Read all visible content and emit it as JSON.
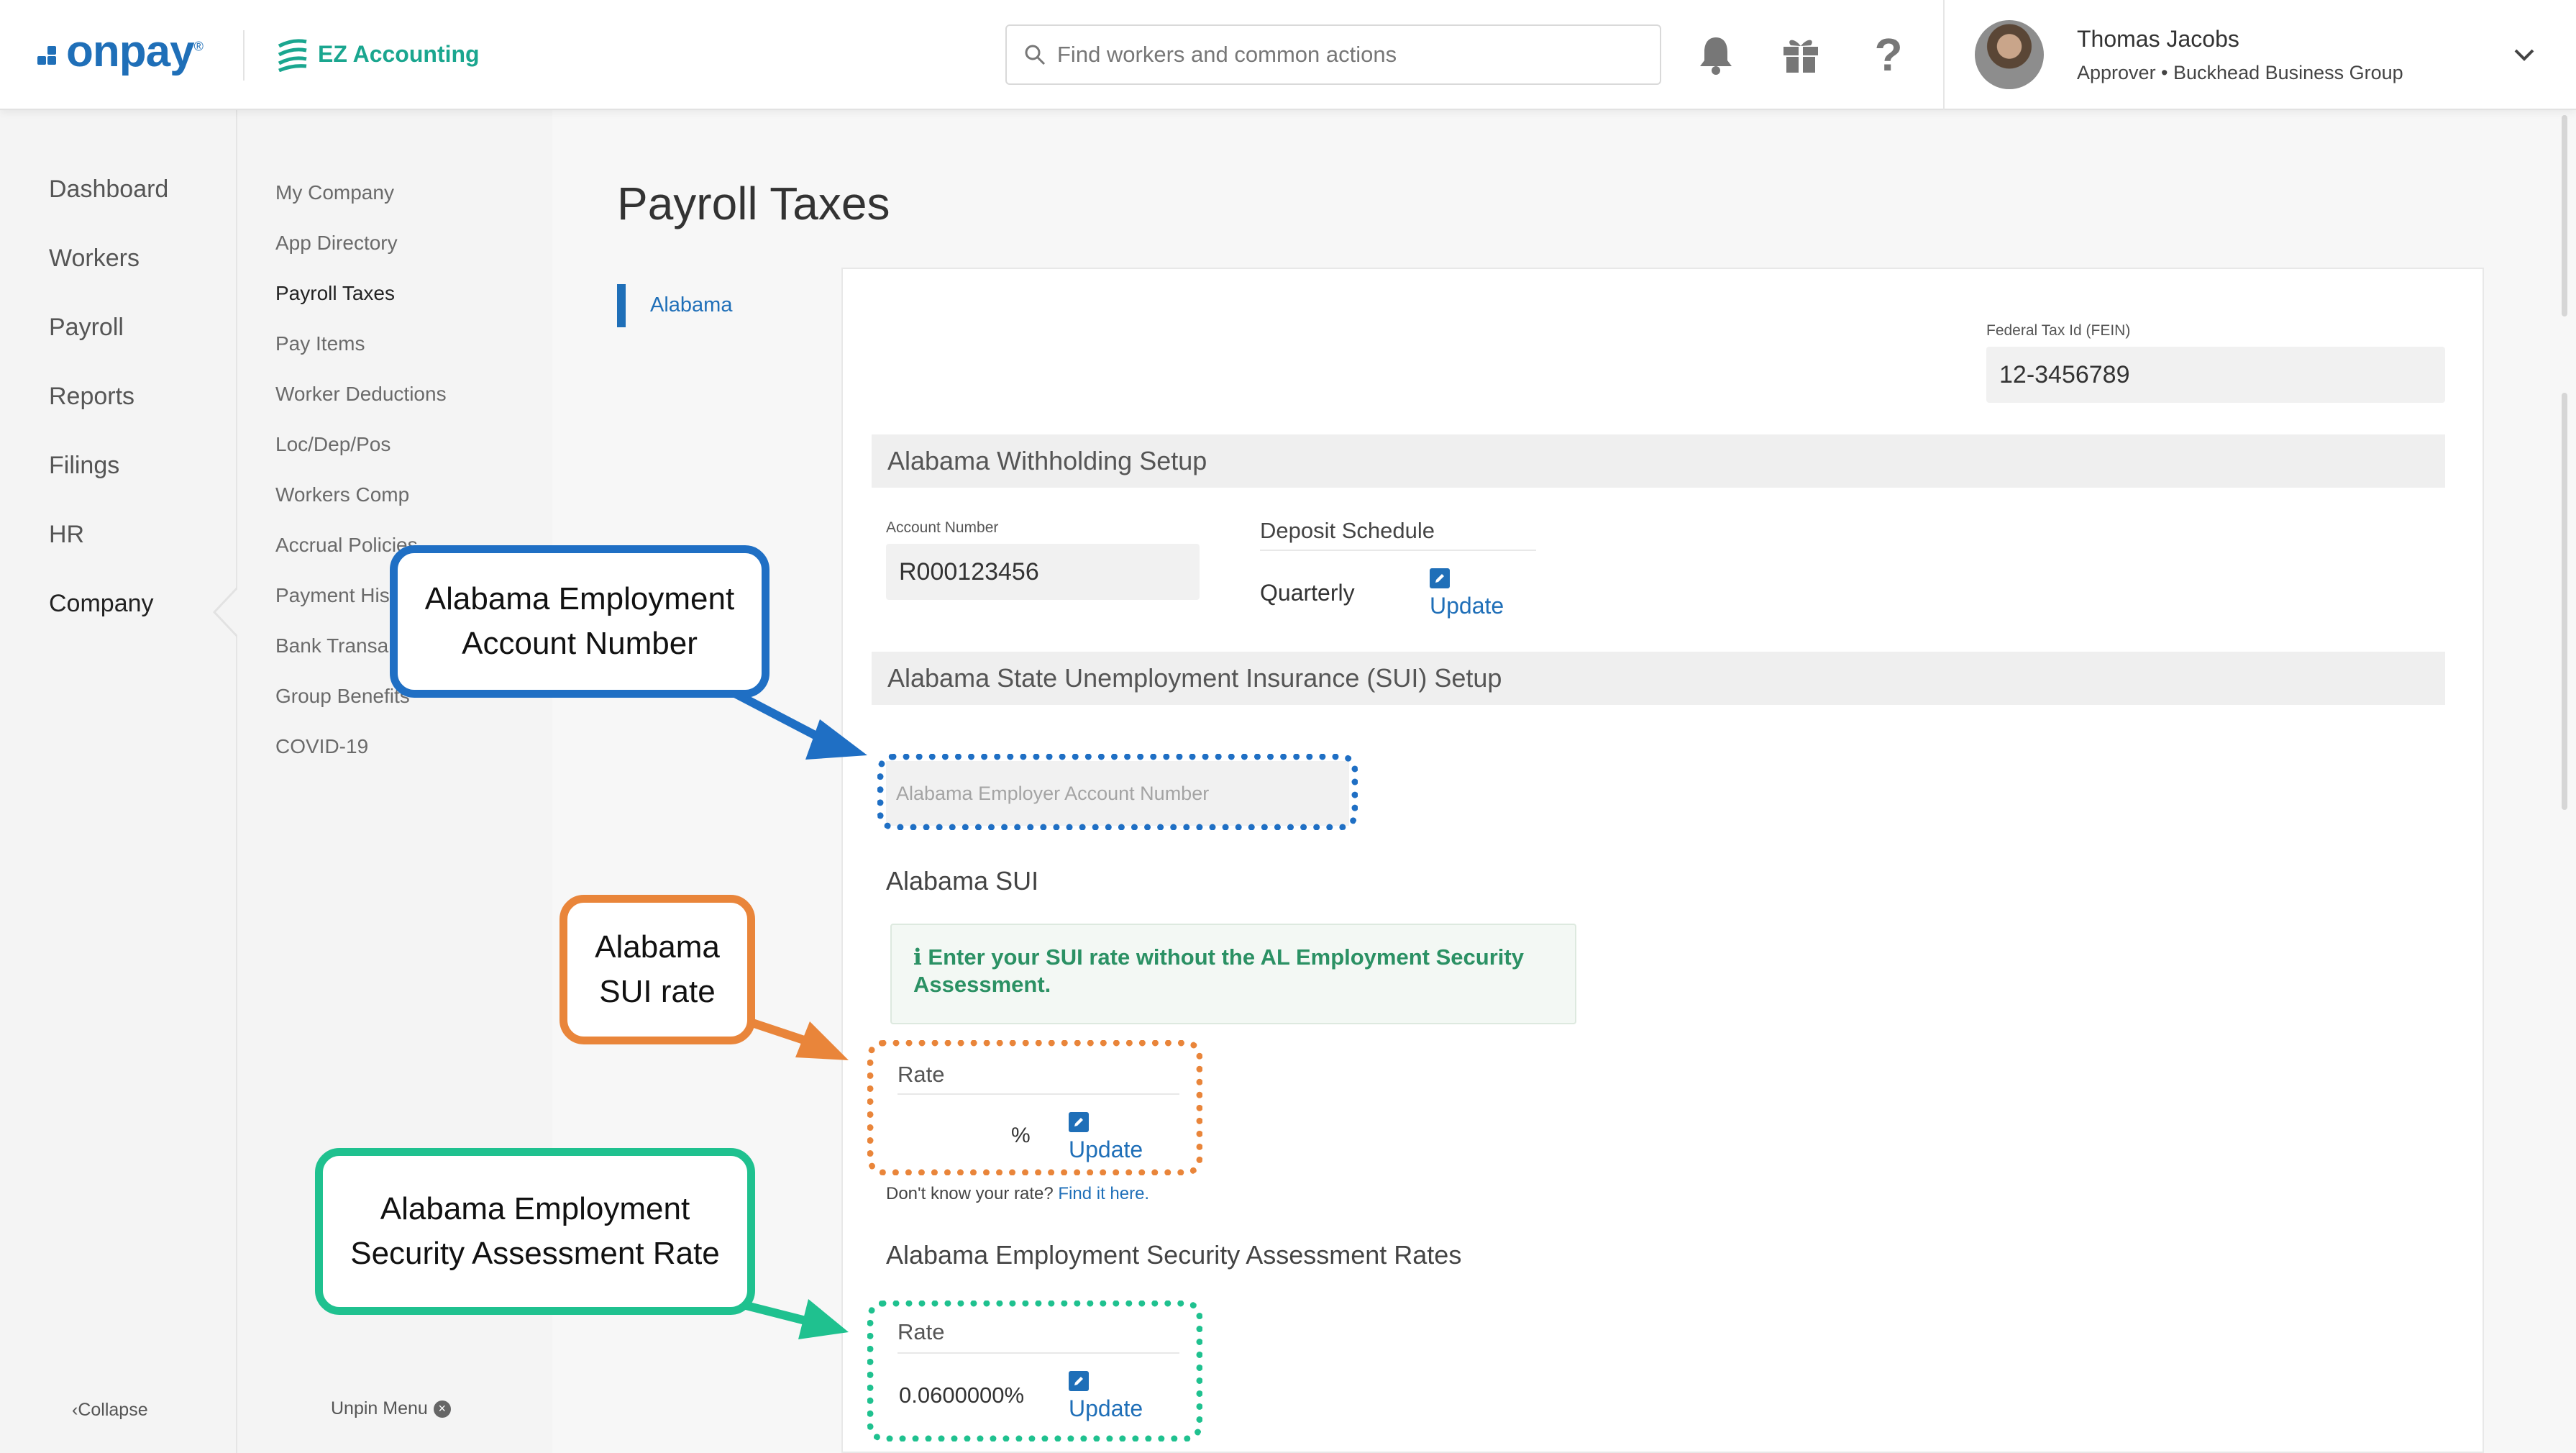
{
  "header": {
    "brand": "onpay",
    "brand_mark": "®",
    "partner": "EZ Accounting",
    "search_placeholder": "Find workers and common actions",
    "icons": [
      "bell-icon",
      "gift-icon",
      "help-icon"
    ],
    "user": {
      "name": "Thomas Jacobs",
      "role": "Approver • Buckhead Business Group"
    }
  },
  "nav_primary": [
    "Dashboard",
    "Workers",
    "Payroll",
    "Reports",
    "Filings",
    "HR",
    "Company"
  ],
  "nav_secondary": [
    "My Company",
    "App Directory",
    "Payroll Taxes",
    "Pay Items",
    "Worker Deductions",
    "Loc/Dep/Pos",
    "Workers Comp",
    "Accrual Policies",
    "Payment His",
    "Bank Transa",
    "Group Benefits",
    "COVID-19"
  ],
  "footer": {
    "collapse": "Collapse",
    "unpin": "Unpin Menu"
  },
  "page": {
    "title": "Payroll Taxes",
    "state_tab": "Alabama",
    "fein_label": "Federal Tax Id (FEIN)",
    "fein_value": "12-3456789",
    "withholding": {
      "header": "Alabama Withholding Setup",
      "account_label": "Account Number",
      "account_value": "R000123456",
      "deposit_label": "Deposit Schedule",
      "deposit_value": "Quarterly",
      "update": "Update"
    },
    "sui": {
      "header": "Alabama State Unemployment Insurance (SUI) Setup",
      "employer_placeholder": "Alabama Employer Account Number",
      "subheading": "Alabama SUI",
      "info": "Enter your SUI rate without the AL Employment Security Assessment.",
      "rate_label": "Rate",
      "rate_unit": "%",
      "update": "Update",
      "help_text": "Don't know your rate?",
      "help_link": "Find it here."
    },
    "esa": {
      "subheading": "Alabama Employment Security Assessment Rates",
      "rate_label": "Rate",
      "rate_value": "0.0600000%",
      "update": "Update"
    }
  },
  "annotations": {
    "blue": {
      "line1": "Alabama Employment",
      "line2": "Account Number",
      "color": "#1f6fc4"
    },
    "orange": {
      "line1": "Alabama",
      "line2": "SUI rate",
      "color": "#e9853a"
    },
    "green": {
      "line1": "Alabama Employment",
      "line2": "Security Assessment Rate",
      "color": "#1fc18f"
    }
  }
}
